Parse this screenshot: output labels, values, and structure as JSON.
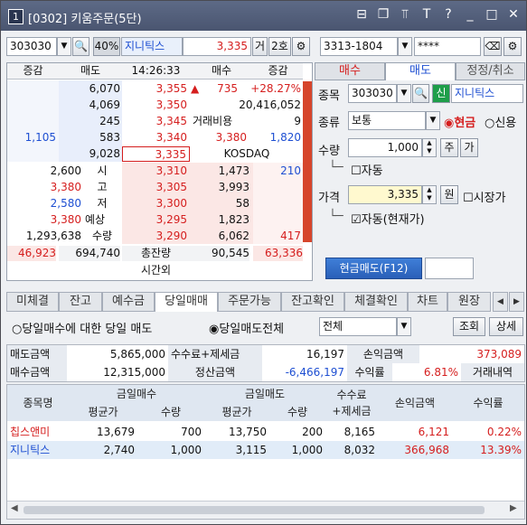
{
  "window": {
    "number": "1",
    "title": "[0302] 키움주문(5단)"
  },
  "titlebar_icons": [
    "window-icon",
    "copy-icon",
    "pin-icon",
    "text-icon",
    "help-icon",
    "minimize-icon",
    "maximize-icon",
    "close-icon"
  ],
  "titlebar_glyphs": {
    "window": "⊟",
    "copy": "❐",
    "pin": "⫪",
    "text": "T",
    "help": "?",
    "min": "_",
    "max": "□",
    "close": "✕"
  },
  "topbar": {
    "code": "303030",
    "percent": "40%",
    "name": "지니틱스",
    "price": "3,335",
    "geo": "거",
    "row": "2호"
  },
  "account": {
    "number": "3313-1804",
    "password": "****"
  },
  "orderbook": {
    "headers": [
      "증감",
      "매도",
      "14:26:33",
      "매수",
      "증감"
    ],
    "asks": [
      {
        "qty": "6,070",
        "price": "3,355"
      },
      {
        "qty": "4,069",
        "price": "3,350"
      },
      {
        "qty": "245",
        "price": "3,345"
      },
      {
        "chg": "1,105",
        "qty": "583",
        "price": "3,340"
      },
      {
        "qty": "9,028",
        "price": "3,335"
      }
    ],
    "ask_side": {
      "arrow": "▲",
      "v1": "735",
      "pct": "+28.27%",
      "volume": "20,416,052",
      "vol_ratio_label": "거래비용",
      "vol_ratio": "9",
      "p1": "3,380",
      "p1b": "1,820",
      "market": "KOSDAQ"
    },
    "left_info": [
      {
        "val": "2,600",
        "lbl": "시"
      },
      {
        "val": "3,380",
        "lbl": "고"
      },
      {
        "val": "2,580",
        "lbl": "저"
      },
      {
        "val": "3,380",
        "lbl": "예상"
      },
      {
        "val": "1,293,638",
        "lbl": "수량"
      }
    ],
    "bids": [
      {
        "price": "3,310",
        "qty": "1,473",
        "chg": "210"
      },
      {
        "price": "3,305",
        "qty": "3,993",
        "chg": ""
      },
      {
        "price": "3,300",
        "qty": "58",
        "chg": ""
      },
      {
        "price": "3,295",
        "qty": "1,823",
        "chg": ""
      },
      {
        "price": "3,290",
        "qty": "6,062",
        "chg": "417"
      }
    ],
    "totals": {
      "left_chg": "46,923",
      "ask_total": "694,740",
      "label": "총잔량",
      "bid_total": "90,545",
      "right_chg": "63,336"
    },
    "after_hours": "시간외"
  },
  "order_panel": {
    "tabs": [
      "매수",
      "매도",
      "정정/취소"
    ],
    "code_label": "종목",
    "code": "303030",
    "credit": "신",
    "name": "지니틱스",
    "type_label": "종류",
    "type_value": "보통",
    "radio1": "현금",
    "radio2": "신용",
    "qty_label": "수량",
    "qty": "1,000",
    "qty_btn1": "주",
    "qty_btn2": "가",
    "auto_label": "자동",
    "price_label": "가격",
    "price": "3,335",
    "price_unit": "원",
    "market_price": "시장가",
    "auto_current": "자동(현재가)",
    "submit": "현금매도(F12)"
  },
  "tabs2": [
    "미체결",
    "잔고",
    "예수금",
    "당일매매",
    "주문가능",
    "잔고확인",
    "체결확인",
    "차트",
    "원장"
  ],
  "filter": {
    "radio1": "당일매수에 대한 당일 매도",
    "radio2": "당일매도전체",
    "select": "전체",
    "btn1": "조회",
    "btn2": "상세"
  },
  "summary": {
    "sell_amt_label": "매도금액",
    "sell_amt": "5,865,000",
    "fee_label": "수수료+제세금",
    "fee": "16,197",
    "pnl_label": "손익금액",
    "pnl": "373,089",
    "buy_amt_label": "매수금액",
    "buy_amt": "12,315,000",
    "settle_label": "정산금액",
    "settle": "-6,466,197",
    "rate_label": "수익률",
    "rate": "6.81%",
    "history": "거래내역"
  },
  "table": {
    "h_name": "종목명",
    "h_buy": "금일매수",
    "h_sell": "금일매도",
    "h_fee": "수수료\n+제세금",
    "h_pnl": "손익금액",
    "h_rate": "수익률",
    "h_avg1": "평균가",
    "h_qty1": "수량",
    "h_avg2": "평균가",
    "h_qty2": "수량",
    "rows": [
      {
        "name": "칩스앤미",
        "buy_avg": "13,679",
        "buy_qty": "700",
        "sell_avg": "13,750",
        "sell_qty": "200",
        "fee": "8,165",
        "pnl": "6,121",
        "rate": "0.22%"
      },
      {
        "name": "지니틱스",
        "buy_avg": "2,740",
        "buy_qty": "1,000",
        "sell_avg": "3,115",
        "sell_qty": "1,000",
        "fee": "8,032",
        "pnl": "366,968",
        "rate": "13.39%"
      }
    ]
  }
}
